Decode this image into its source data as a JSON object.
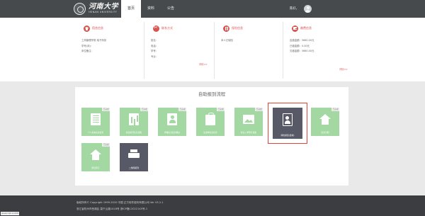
{
  "header": {
    "logo_cn": "河南大学",
    "logo_en": "HENAN UNIVERSITY",
    "nav": [
      {
        "label": "首页",
        "active": true
      },
      {
        "label": "资料",
        "active": false
      },
      {
        "label": "公告",
        "active": false
      }
    ],
    "user_name": "陈好，"
  },
  "info": {
    "dorm": {
      "title": "宿舍信息",
      "lines": [
        "工商管理学院-电子商务",
        "学号(床)：",
        "床位备注："
      ]
    },
    "contact": {
      "title": "联系方式",
      "lines": [
        "姓名：",
        "电话：",
        "学号：",
        "专业："
      ],
      "more": "详情>>"
    },
    "insurance": {
      "title": "保险信息",
      "lines": [
        "本人已保险"
      ]
    },
    "payment": {
      "title": "缴费信息",
      "lines": [
        "应缴金额：5660.00元",
        "已缴金额：0.00元",
        "欠缴金额：5660.00元"
      ],
      "more": "详情>>"
    }
  },
  "flow": {
    "title": "自助报到流程",
    "tiles": [
      {
        "label": "个人基本信息核查",
        "tag": "已完成",
        "icon": "doc-icon"
      },
      {
        "label": "家庭情况信息采集",
        "tag": "已完成",
        "icon": "chart-icon"
      },
      {
        "label": "学籍信息核对确认",
        "tag": "已完成",
        "icon": "person-icon"
      },
      {
        "label": "生源地信息核查",
        "tag": "已完成",
        "icon": "bag-icon"
      },
      {
        "label": "新生入学照片采集",
        "tag": "已完成",
        "icon": "photo-icon"
      },
      {
        "label": "绿色通道(选填)",
        "tag": "",
        "icon": "id-card-icon"
      },
      {
        "label": "宿舍分配",
        "tag": "已完成",
        "icon": "home-icon"
      },
      {
        "label": "床位预订",
        "tag": "已完成",
        "icon": "home-icon"
      },
      {
        "label": "二维码报到",
        "tag": "",
        "icon": "printer-icon"
      }
    ]
  },
  "footer": {
    "line1": "版权所有© Copyright 1999-2020 中国 正方软件股份有限公司 Ver V5.2.1",
    "line2": "浙江省杭州市西湖区 莫干山路1418号 浙ICP备12022145号-1"
  },
  "status_url": "javascript:void(0)",
  "colors": {
    "header": "#474a4d",
    "accent": "#d9534f",
    "tile_green": "#a3d8a3",
    "tile_dark": "#575a66",
    "highlight": "#e2443a"
  }
}
